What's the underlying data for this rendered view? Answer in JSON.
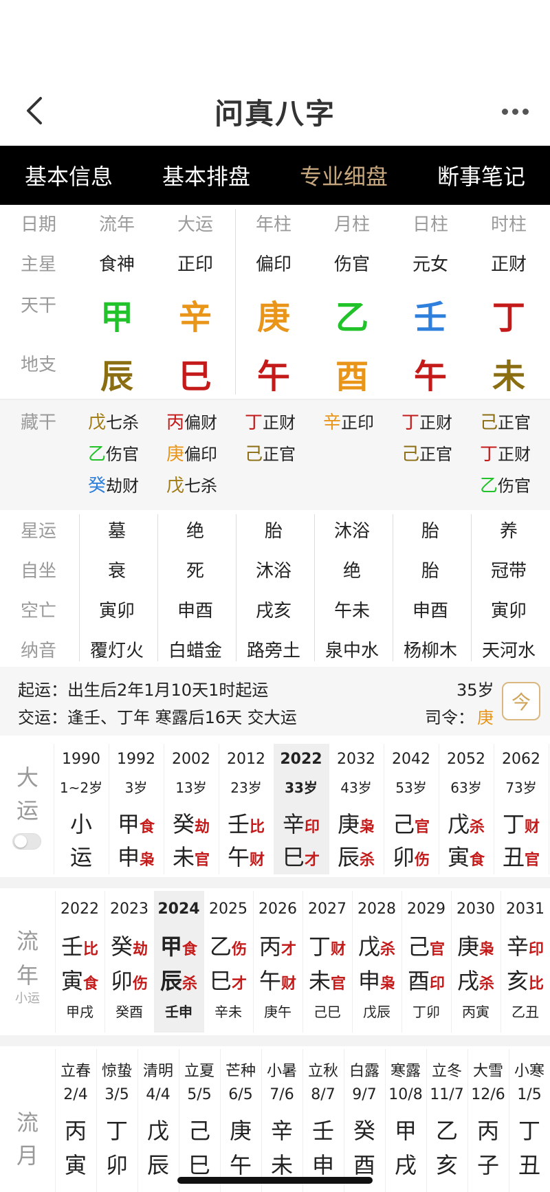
{
  "header": {
    "title": "问真八字"
  },
  "tabs": [
    "基本信息",
    "基本排盘",
    "专业细盘",
    "断事笔记"
  ],
  "active_tab": 2,
  "grid": {
    "labels": [
      "日期",
      "主星",
      "天干",
      "地支"
    ],
    "columns": [
      {
        "head": "流年",
        "star": "食神",
        "gan": "甲",
        "gan_color": "#22c22a",
        "zhi": "辰",
        "zhi_color": "#8b6d12"
      },
      {
        "head": "大运",
        "star": "正印",
        "gan": "辛",
        "gan_color": "#e8951a",
        "zhi": "巳",
        "zhi_color": "#c41a1a"
      },
      {
        "head": "年柱",
        "star": "偏印",
        "gan": "庚",
        "gan_color": "#e8951a",
        "zhi": "午",
        "zhi_color": "#c41a1a"
      },
      {
        "head": "月柱",
        "star": "伤官",
        "gan": "乙",
        "gan_color": "#22c22a",
        "zhi": "酉",
        "zhi_color": "#e8951a"
      },
      {
        "head": "日柱",
        "star": "元女",
        "gan": "壬",
        "gan_color": "#2f7fdc",
        "zhi": "午",
        "zhi_color": "#c41a1a"
      },
      {
        "head": "时柱",
        "star": "正财",
        "gan": "丁",
        "gan_color": "#c41a1a",
        "zhi": "未",
        "zhi_color": "#8b6d12"
      }
    ]
  },
  "canggan": {
    "label": "藏干",
    "columns": [
      [
        {
          "g": "戊",
          "c": "#a07a12",
          "t": "七杀"
        },
        {
          "g": "乙",
          "c": "#22c22a",
          "t": "伤官"
        },
        {
          "g": "癸",
          "c": "#2f7fdc",
          "t": "劫财"
        }
      ],
      [
        {
          "g": "丙",
          "c": "#c41a1a",
          "t": "偏财"
        },
        {
          "g": "庚",
          "c": "#e8951a",
          "t": "偏印"
        },
        {
          "g": "戊",
          "c": "#a07a12",
          "t": "七杀"
        }
      ],
      [
        {
          "g": "丁",
          "c": "#c41a1a",
          "t": "正财"
        },
        {
          "g": "己",
          "c": "#8b6d12",
          "t": "正官"
        }
      ],
      [
        {
          "g": "辛",
          "c": "#e8951a",
          "t": "正印"
        }
      ],
      [
        {
          "g": "丁",
          "c": "#c41a1a",
          "t": "正财"
        },
        {
          "g": "己",
          "c": "#8b6d12",
          "t": "正官"
        }
      ],
      [
        {
          "g": "己",
          "c": "#8b6d12",
          "t": "正官"
        },
        {
          "g": "丁",
          "c": "#c41a1a",
          "t": "正财"
        },
        {
          "g": "乙",
          "c": "#22c22a",
          "t": "伤官"
        }
      ]
    ]
  },
  "lower": {
    "labels": [
      "星运",
      "自坐",
      "空亡",
      "纳音"
    ],
    "rows": [
      [
        "墓",
        "绝",
        "胎",
        "沐浴",
        "胎",
        "养"
      ],
      [
        "衰",
        "死",
        "沐浴",
        "绝",
        "胎",
        "冠带"
      ],
      [
        "寅卯",
        "申酉",
        "戌亥",
        "午未",
        "申酉",
        "寅卯"
      ],
      [
        "覆灯火",
        "白蜡金",
        "路旁土",
        "泉中水",
        "杨柳木",
        "天河水"
      ]
    ]
  },
  "info": {
    "qiyun": "起运：出生后2年1月10天1时起运",
    "jiaoyun": "交运：逢壬、丁年 寒露后16天 交大运",
    "age": "35岁",
    "siling_label": "司令：",
    "siling_value": "庚",
    "siling_color": "#e8951a",
    "icon_glyph": "今"
  },
  "dayun": {
    "label": [
      "大",
      "运"
    ],
    "first": {
      "year": "1990",
      "age": "1~2岁",
      "top": "小",
      "bottom": "运"
    },
    "items": [
      {
        "year": "1992",
        "age": "3岁",
        "g": "甲",
        "gs": "食",
        "z": "申",
        "zs": "枭"
      },
      {
        "year": "2002",
        "age": "13岁",
        "g": "癸",
        "gs": "劫",
        "z": "未",
        "zs": "官"
      },
      {
        "year": "2012",
        "age": "23岁",
        "g": "壬",
        "gs": "比",
        "z": "午",
        "zs": "财"
      },
      {
        "year": "2022",
        "age": "33岁",
        "g": "辛",
        "gs": "印",
        "z": "巳",
        "zs": "才",
        "selected": true
      },
      {
        "year": "2032",
        "age": "43岁",
        "g": "庚",
        "gs": "枭",
        "z": "辰",
        "zs": "杀"
      },
      {
        "year": "2042",
        "age": "53岁",
        "g": "己",
        "gs": "官",
        "z": "卯",
        "zs": "伤"
      },
      {
        "year": "2052",
        "age": "63岁",
        "g": "戊",
        "gs": "杀",
        "z": "寅",
        "zs": "食"
      },
      {
        "year": "2062",
        "age": "73岁",
        "g": "丁",
        "gs": "财",
        "z": "丑",
        "zs": "官"
      }
    ]
  },
  "liunian": {
    "label": [
      "流",
      "年"
    ],
    "sub": "小运",
    "items": [
      {
        "year": "2022",
        "g": "壬",
        "gs": "比",
        "z": "寅",
        "zs": "食",
        "xy": "甲戌"
      },
      {
        "year": "2023",
        "g": "癸",
        "gs": "劫",
        "z": "卯",
        "zs": "伤",
        "xy": "癸酉"
      },
      {
        "year": "2024",
        "g": "甲",
        "gs": "食",
        "z": "辰",
        "zs": "杀",
        "xy": "壬申",
        "selected": true
      },
      {
        "year": "2025",
        "g": "乙",
        "gs": "伤",
        "z": "巳",
        "zs": "才",
        "xy": "辛未"
      },
      {
        "year": "2026",
        "g": "丙",
        "gs": "才",
        "z": "午",
        "zs": "财",
        "xy": "庚午"
      },
      {
        "year": "2027",
        "g": "丁",
        "gs": "财",
        "z": "未",
        "zs": "官",
        "xy": "己巳"
      },
      {
        "year": "2028",
        "g": "戊",
        "gs": "杀",
        "z": "申",
        "zs": "枭",
        "xy": "戊辰"
      },
      {
        "year": "2029",
        "g": "己",
        "gs": "官",
        "z": "酉",
        "zs": "印",
        "xy": "丁卯"
      },
      {
        "year": "2030",
        "g": "庚",
        "gs": "枭",
        "z": "戌",
        "zs": "杀",
        "xy": "丙寅"
      },
      {
        "year": "2031",
        "g": "辛",
        "gs": "印",
        "z": "亥",
        "zs": "比",
        "xy": "乙丑"
      }
    ]
  },
  "liuyue": {
    "label": [
      "流",
      "月"
    ],
    "items": [
      {
        "jie": "立春",
        "date": "2/4",
        "g": "丙",
        "z": "寅"
      },
      {
        "jie": "惊蛰",
        "date": "3/5",
        "g": "丁",
        "z": "卯"
      },
      {
        "jie": "清明",
        "date": "4/4",
        "g": "戊",
        "z": "辰"
      },
      {
        "jie": "立夏",
        "date": "5/5",
        "g": "己",
        "z": "巳"
      },
      {
        "jie": "芒种",
        "date": "6/5",
        "g": "庚",
        "z": "午"
      },
      {
        "jie": "小暑",
        "date": "7/6",
        "g": "辛",
        "z": "未"
      },
      {
        "jie": "立秋",
        "date": "8/7",
        "g": "壬",
        "z": "申"
      },
      {
        "jie": "白露",
        "date": "9/7",
        "g": "癸",
        "z": "酉"
      },
      {
        "jie": "寒露",
        "date": "10/8",
        "g": "甲",
        "z": "戌"
      },
      {
        "jie": "立冬",
        "date": "11/7",
        "g": "乙",
        "z": "亥"
      },
      {
        "jie": "大雪",
        "date": "12/6",
        "g": "丙",
        "z": "子"
      },
      {
        "jie": "小寒",
        "date": "1/5",
        "g": "丁",
        "z": "丑"
      }
    ]
  }
}
